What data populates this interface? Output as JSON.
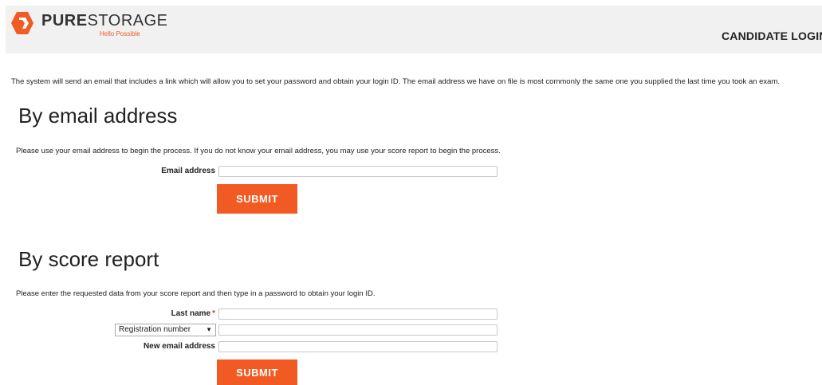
{
  "header": {
    "logo_text_bold": "PURE",
    "logo_text_light": "STORAGE",
    "tagline": "Hello Possible",
    "nav_login": "CANDIDATE LOGIN"
  },
  "intro_text": "The system will send an email that includes a link which will allow you to set your password and obtain your login ID. The email address we have on file is most commonly the same one you supplied the last time you took an exam.",
  "email_section": {
    "title": "By email address",
    "description": "Please use your email address to begin the process. If you do not know your email address, you may use your score report to begin the process.",
    "email_label": "Email address",
    "email_value": "",
    "submit_label": "SUBMIT"
  },
  "score_section": {
    "title": "By score report",
    "description": "Please enter the requested data from your score report and then type in a password to obtain your login ID.",
    "last_name_label": "Last name",
    "required_mark": "*",
    "id_type_selected": "Registration number",
    "new_email_label": "New email address",
    "submit_label": "SUBMIT"
  },
  "colors": {
    "brand_orange": "#f15a22",
    "header_bg": "#f1f1f1"
  },
  "icons": {
    "logo": "pure-storage-logo-icon",
    "dropdown": "chevron-down-icon"
  }
}
